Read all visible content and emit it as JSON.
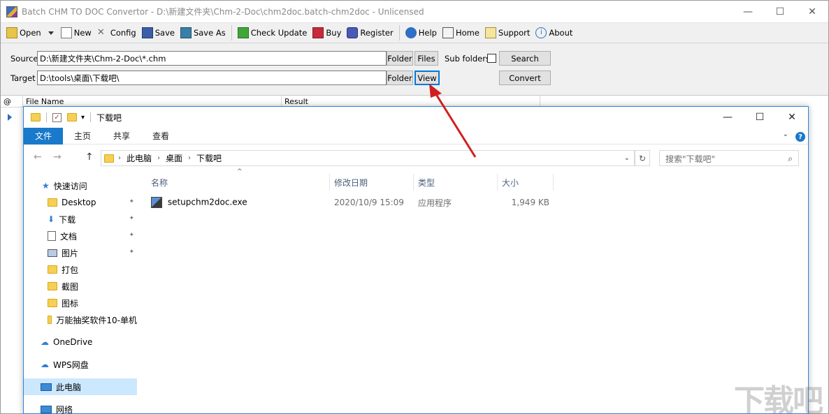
{
  "app": {
    "title": "Batch CHM TO DOC Convertor - D:\\新建文件夹\\Chm-2-Doc\\chm2doc.batch-chm2doc - Unlicensed",
    "window_buttons": {
      "minimize": "—",
      "maximize": "☐",
      "close": "✕"
    }
  },
  "toolbar": {
    "open": "Open",
    "new": "New",
    "config": "Config",
    "save": "Save",
    "save_as": "Save As",
    "check_update": "Check Update",
    "buy": "Buy",
    "register": "Register",
    "help": "Help",
    "home": "Home",
    "support": "Support",
    "about": "About"
  },
  "source": {
    "label": "Source",
    "value": "D:\\新建文件夹\\Chm-2-Doc\\*.chm",
    "folder_btn": "Folder",
    "files_btn": "Files",
    "subfolders_label": "Sub folders",
    "search_btn": "Search"
  },
  "target": {
    "label": "Target",
    "value": "D:\\tools\\桌面\\下载吧\\",
    "folder_btn": "Folder",
    "view_btn": "View",
    "convert_btn": "Convert"
  },
  "grid": {
    "col_at": "@",
    "col_filename": "File Name",
    "col_result": "Result"
  },
  "explorer": {
    "title": "下载吧",
    "qa_dropdown": "▾",
    "window_buttons": {
      "minimize": "—",
      "maximize": "☐",
      "close": "✕"
    },
    "ribbon_tabs": [
      "文件",
      "主页",
      "共享",
      "查看"
    ],
    "help": "?",
    "chevron": "⌄",
    "nav": {
      "back": "←",
      "forward": "→",
      "up": "↑"
    },
    "breadcrumbs": [
      "此电脑",
      "桌面",
      "下载吧"
    ],
    "refresh": "↻",
    "search_placeholder": "搜索\"下载吧\"",
    "search_icon": "⌕",
    "sidebar": [
      {
        "label": "快速访问",
        "icon": "star-icon"
      },
      {
        "label": "Desktop",
        "icon": "folder-icon",
        "pinned": true
      },
      {
        "label": "下载",
        "icon": "download-icon",
        "pinned": true
      },
      {
        "label": "文档",
        "icon": "document-icon",
        "pinned": true
      },
      {
        "label": "图片",
        "icon": "picture-icon",
        "pinned": true
      },
      {
        "label": "打包",
        "icon": "folder-icon"
      },
      {
        "label": "截图",
        "icon": "folder-icon"
      },
      {
        "label": "图标",
        "icon": "folder-icon"
      },
      {
        "label": "万能抽奖软件10-单机",
        "icon": "folder-icon"
      },
      {
        "label": "OneDrive",
        "icon": "cloud-icon"
      },
      {
        "label": "WPS网盘",
        "icon": "cloud-icon"
      },
      {
        "label": "此电脑",
        "icon": "computer-icon",
        "selected": true
      },
      {
        "label": "网络",
        "icon": "network-icon"
      }
    ],
    "columns": [
      "名称",
      "修改日期",
      "类型",
      "大小"
    ],
    "files": [
      {
        "name": "setupchm2doc.exe",
        "modified": "2020/10/9 15:09",
        "type": "应用程序",
        "size": "1,949 KB"
      }
    ]
  },
  "watermark": "下载吧",
  "colors": {
    "accent": "#1979ca",
    "arrow": "#d11f1f",
    "selected": "#cce8ff"
  }
}
